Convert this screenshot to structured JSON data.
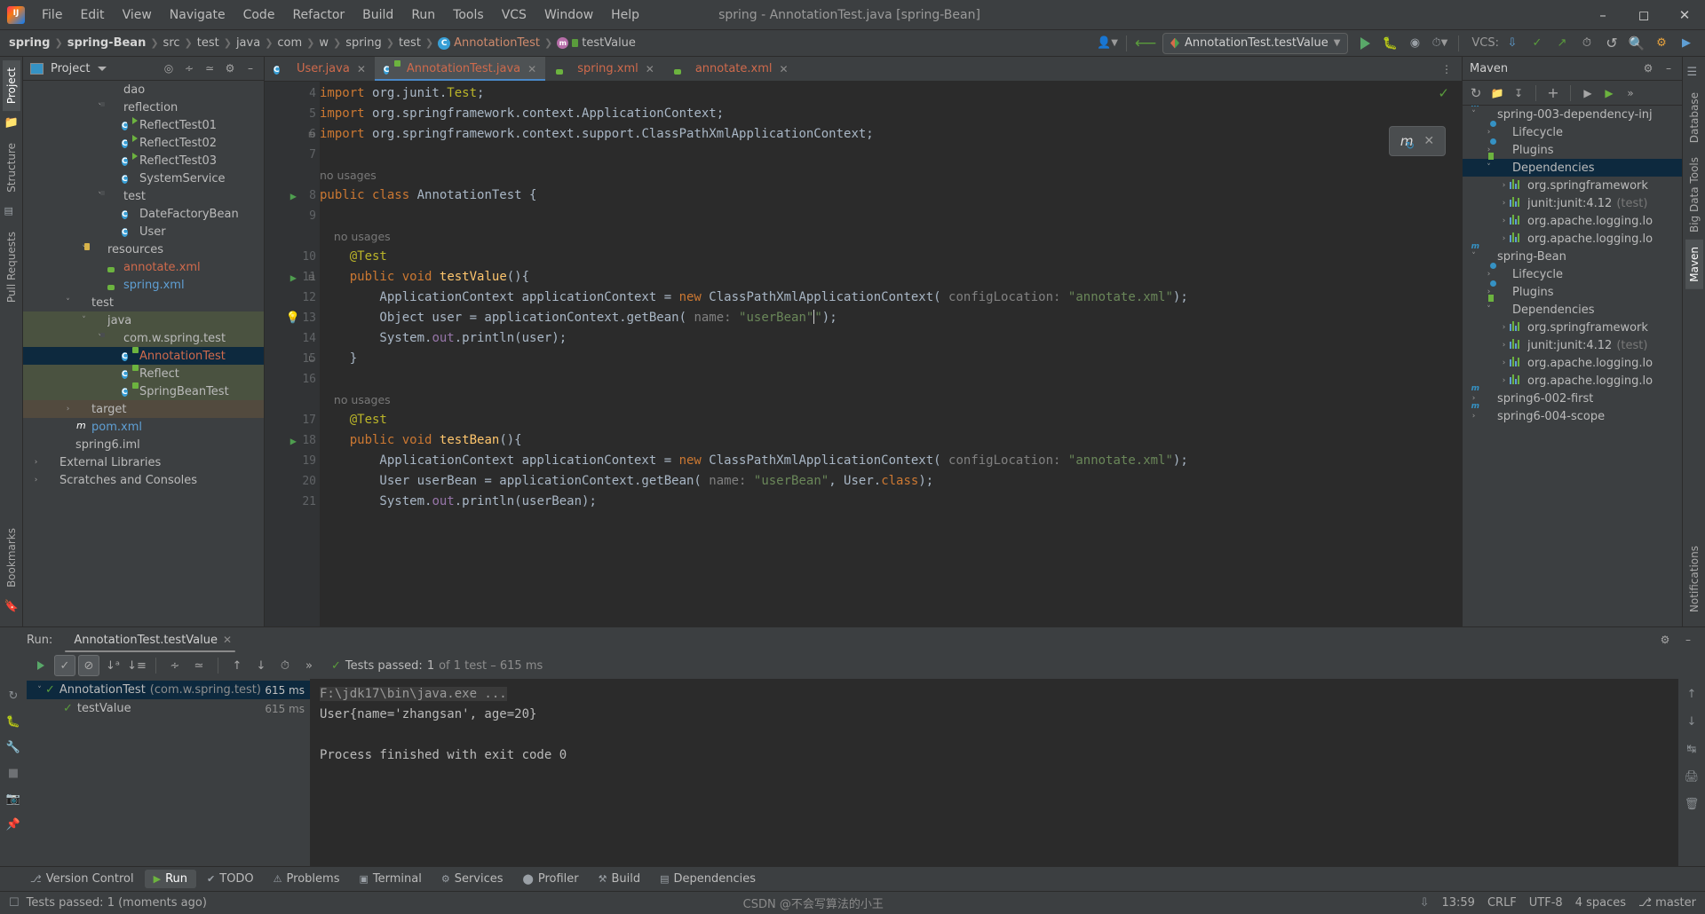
{
  "titlebar": {
    "app_icon": "intellij-logo",
    "menus": [
      "File",
      "Edit",
      "View",
      "Navigate",
      "Code",
      "Refactor",
      "Build",
      "Run",
      "Tools",
      "VCS",
      "Window",
      "Help"
    ],
    "window_title": "spring - AnnotationTest.java [spring-Bean]",
    "controls": [
      "minimize",
      "maximize",
      "close"
    ]
  },
  "navbar": {
    "crumbs": [
      "spring",
      "spring-Bean",
      "src",
      "test",
      "java",
      "com",
      "w",
      "spring",
      "test",
      "AnnotationTest",
      "testValue"
    ],
    "run_config": "AnnotationTest.testValue",
    "vcs_label": "VCS:",
    "icons": [
      "user-icon",
      "back-arrow-icon",
      "run-icon",
      "debug-icon",
      "coverage-icon",
      "profile-icon",
      "search-icon",
      "settings-icon"
    ]
  },
  "left_rail": {
    "tabs": [
      "Project",
      "Structure",
      "Pull Requests"
    ],
    "active_tab": "Project",
    "bottom_tabs": [
      "Bookmarks"
    ]
  },
  "right_rail": {
    "tabs": [
      "Database",
      "Big Data Tools",
      "Maven",
      "Notifications"
    ]
  },
  "project_panel": {
    "title": "Project",
    "actions": [
      "locate-icon",
      "expand-all-icon",
      "collapse-all-icon",
      "gear-icon",
      "minimize-icon"
    ],
    "tree": [
      {
        "indent": 4,
        "arrow": "",
        "icon": "folder",
        "label": "dao",
        "cls": "",
        "sel": ""
      },
      {
        "indent": 4,
        "arrow": "v",
        "icon": "folder-pkg",
        "label": "reflection",
        "cls": "",
        "sel": ""
      },
      {
        "indent": 5,
        "arrow": "",
        "icon": "class-run",
        "label": "ReflectTest01",
        "cls": "",
        "sel": ""
      },
      {
        "indent": 5,
        "arrow": "",
        "icon": "class-run",
        "label": "ReflectTest02",
        "cls": "",
        "sel": ""
      },
      {
        "indent": 5,
        "arrow": "",
        "icon": "class-run",
        "label": "ReflectTest03",
        "cls": "",
        "sel": ""
      },
      {
        "indent": 5,
        "arrow": "",
        "icon": "class",
        "label": "SystemService",
        "cls": "",
        "sel": ""
      },
      {
        "indent": 4,
        "arrow": "v",
        "icon": "folder-pkg",
        "label": "test",
        "cls": "",
        "sel": ""
      },
      {
        "indent": 5,
        "arrow": "",
        "icon": "class",
        "label": "DateFactoryBean",
        "cls": "",
        "sel": ""
      },
      {
        "indent": 5,
        "arrow": "",
        "icon": "class",
        "label": "User",
        "cls": "",
        "sel": ""
      },
      {
        "indent": 3,
        "arrow": "v",
        "icon": "folder-res",
        "label": "resources",
        "cls": "",
        "sel": ""
      },
      {
        "indent": 4,
        "arrow": "",
        "icon": "xml",
        "label": "annotate.xml",
        "cls": "red",
        "sel": ""
      },
      {
        "indent": 4,
        "arrow": "",
        "icon": "xml",
        "label": "spring.xml",
        "cls": "blue",
        "sel": ""
      },
      {
        "indent": 2,
        "arrow": "v",
        "icon": "folder",
        "label": "test",
        "cls": "",
        "sel": ""
      },
      {
        "indent": 3,
        "arrow": "v",
        "icon": "folder-src",
        "label": "java",
        "cls": "",
        "sel": "green"
      },
      {
        "indent": 4,
        "arrow": "v",
        "icon": "folder-pkg",
        "label": "com.w.spring.test",
        "cls": "",
        "sel": "green"
      },
      {
        "indent": 5,
        "arrow": "",
        "icon": "class-test",
        "label": "AnnotationTest",
        "cls": "red",
        "sel": "blue"
      },
      {
        "indent": 5,
        "arrow": "",
        "icon": "class-test",
        "label": "Reflect",
        "cls": "",
        "sel": "green"
      },
      {
        "indent": 5,
        "arrow": "",
        "icon": "class-test",
        "label": "SpringBeanTest",
        "cls": "",
        "sel": "green"
      },
      {
        "indent": 2,
        "arrow": ">",
        "icon": "folder-target",
        "label": "target",
        "cls": "",
        "sel": "brown"
      },
      {
        "indent": 2,
        "arrow": "",
        "icon": "pom",
        "label": "pom.xml",
        "cls": "blue",
        "sel": ""
      },
      {
        "indent": 1,
        "arrow": "",
        "icon": "iml",
        "label": "spring6.iml",
        "cls": "",
        "sel": ""
      },
      {
        "indent": 0,
        "arrow": ">",
        "icon": "lib",
        "label": "External Libraries",
        "cls": "",
        "sel": ""
      },
      {
        "indent": 0,
        "arrow": ">",
        "icon": "lib",
        "label": "Scratches and Consoles",
        "cls": "",
        "sel": ""
      }
    ]
  },
  "editor": {
    "tabs": [
      {
        "label": "User.java",
        "icon": "java-class-icon",
        "active": false,
        "color": "red"
      },
      {
        "label": "AnnotationTest.java",
        "icon": "java-test-icon",
        "active": true,
        "color": "red"
      },
      {
        "label": "spring.xml",
        "icon": "xml-spring-icon",
        "active": false,
        "color": "red"
      },
      {
        "label": "annotate.xml",
        "icon": "xml-spring-icon",
        "active": false,
        "color": "red"
      }
    ],
    "inspection_status": "ok-check",
    "maven_reload_popup": {
      "icon": "maven-reload-icon",
      "close": "x"
    },
    "lines": [
      {
        "num": "4",
        "gutter": "",
        "fold": "",
        "usage": "",
        "html": "<span class=\"kw\">import</span> org.junit.<span class=\"ann\">Test</span>;"
      },
      {
        "num": "5",
        "gutter": "",
        "fold": "",
        "usage": "",
        "html": "<span class=\"kw\">import</span> org.springframework.context.ApplicationContext;"
      },
      {
        "num": "6",
        "gutter": "",
        "fold": "minus",
        "usage": "",
        "html": "<span class=\"kw\">import</span> org.springframework.context.support.ClassPathXmlApplicationContext;"
      },
      {
        "num": "7",
        "gutter": "",
        "fold": "",
        "usage": "",
        "html": ""
      },
      {
        "num": "",
        "gutter": "",
        "fold": "",
        "usage": "no usages",
        "html": ""
      },
      {
        "num": "8",
        "gutter": "run",
        "fold": "",
        "usage": "",
        "html": "<span class=\"kw\">public class</span> <span class=\"typ\">AnnotationTest</span> {"
      },
      {
        "num": "9",
        "gutter": "",
        "fold": "",
        "usage": "",
        "html": ""
      },
      {
        "num": "",
        "gutter": "",
        "fold": "",
        "usage": "    no usages",
        "html": ""
      },
      {
        "num": "10",
        "gutter": "",
        "fold": "",
        "usage": "",
        "html": "    <span class=\"ann\">@Test</span>"
      },
      {
        "num": "11",
        "gutter": "run",
        "fold": "minus",
        "usage": "",
        "html": "    <span class=\"kw\">public</span> <span class=\"kw\">void</span> <span class=\"mth\">testValue</span>(){"
      },
      {
        "num": "12",
        "gutter": "",
        "fold": "",
        "usage": "",
        "html": "        ApplicationContext applicationContext = <span class=\"kw\">new</span> ClassPathXmlApplicationContext( <span class=\"hint\">configLocation:</span> <span class=\"str\">\"annotate.xml\"</span>);"
      },
      {
        "num": "13",
        "gutter": "bulb",
        "fold": "",
        "usage": "",
        "html": "        Object user = applicationContext.getBean( <span class=\"hint\">name:</span> <span class=\"str\">\"userBean\"</span><span class=\"cursor\"></span><span class=\"str\">\"</span>);"
      },
      {
        "num": "14",
        "gutter": "",
        "fold": "",
        "usage": "",
        "html": "        System.<span class=\"fld\">out</span>.println(user);"
      },
      {
        "num": "15",
        "gutter": "",
        "fold": "up",
        "usage": "",
        "html": "    }"
      },
      {
        "num": "16",
        "gutter": "",
        "fold": "",
        "usage": "",
        "html": ""
      },
      {
        "num": "",
        "gutter": "",
        "fold": "",
        "usage": "    no usages",
        "html": ""
      },
      {
        "num": "17",
        "gutter": "",
        "fold": "",
        "usage": "",
        "html": "    <span class=\"ann\">@Test</span>"
      },
      {
        "num": "18",
        "gutter": "run",
        "fold": "",
        "usage": "",
        "html": "    <span class=\"kw\">public</span> <span class=\"kw\">void</span> <span class=\"mth\">testBean</span>(){"
      },
      {
        "num": "19",
        "gutter": "",
        "fold": "",
        "usage": "",
        "html": "        ApplicationContext applicationContext = <span class=\"kw\">new</span> ClassPathXmlApplicationContext( <span class=\"hint\">configLocation:</span> <span class=\"str\">\"annotate.xml\"</span>);"
      },
      {
        "num": "20",
        "gutter": "",
        "fold": "",
        "usage": "",
        "html": "        User userBean = applicationContext.getBean( <span class=\"hint\">name:</span> <span class=\"str\">\"userBean\"</span>, User.<span class=\"kw\">class</span>);"
      },
      {
        "num": "21",
        "gutter": "",
        "fold": "",
        "usage": "",
        "html": "        System.<span class=\"fld\">out</span>.println(userBean);"
      }
    ]
  },
  "maven_panel": {
    "title": "Maven",
    "toolbar_icons": [
      "reload-icon",
      "add-module-icon",
      "download-sources-icon",
      "plus-icon",
      "run-icon",
      "execute-icon",
      "more-icon"
    ],
    "header_icons": [
      "gear-icon",
      "minimize-icon"
    ],
    "tree": [
      {
        "indent": 0,
        "arrow": "v",
        "icon": "module",
        "label": "spring-003-dependency-inj",
        "dim": "",
        "sel": false
      },
      {
        "indent": 1,
        "arrow": ">",
        "icon": "lifecycle",
        "label": "Lifecycle",
        "dim": "",
        "sel": false
      },
      {
        "indent": 1,
        "arrow": ">",
        "icon": "plugins",
        "label": "Plugins",
        "dim": "",
        "sel": false
      },
      {
        "indent": 1,
        "arrow": "v",
        "icon": "deps",
        "label": "Dependencies",
        "dim": "",
        "sel": true
      },
      {
        "indent": 2,
        "arrow": ">",
        "icon": "bars",
        "label": "org.springframework",
        "dim": "",
        "sel": false
      },
      {
        "indent": 2,
        "arrow": ">",
        "icon": "bars",
        "label": "junit:junit:4.12",
        "dim": "(test)",
        "sel": false
      },
      {
        "indent": 2,
        "arrow": ">",
        "icon": "bars",
        "label": "org.apache.logging.lo",
        "dim": "",
        "sel": false
      },
      {
        "indent": 2,
        "arrow": ">",
        "icon": "bars",
        "label": "org.apache.logging.lo",
        "dim": "",
        "sel": false
      },
      {
        "indent": 0,
        "arrow": "v",
        "icon": "module",
        "label": "spring-Bean",
        "dim": "",
        "sel": false
      },
      {
        "indent": 1,
        "arrow": ">",
        "icon": "lifecycle",
        "label": "Lifecycle",
        "dim": "",
        "sel": false
      },
      {
        "indent": 1,
        "arrow": ">",
        "icon": "plugins",
        "label": "Plugins",
        "dim": "",
        "sel": false
      },
      {
        "indent": 1,
        "arrow": "v",
        "icon": "deps",
        "label": "Dependencies",
        "dim": "",
        "sel": false
      },
      {
        "indent": 2,
        "arrow": ">",
        "icon": "bars",
        "label": "org.springframework",
        "dim": "",
        "sel": false
      },
      {
        "indent": 2,
        "arrow": ">",
        "icon": "bars",
        "label": "junit:junit:4.12",
        "dim": "(test)",
        "sel": false
      },
      {
        "indent": 2,
        "arrow": ">",
        "icon": "bars",
        "label": "org.apache.logging.lo",
        "dim": "",
        "sel": false
      },
      {
        "indent": 2,
        "arrow": ">",
        "icon": "bars",
        "label": "org.apache.logging.lo",
        "dim": "",
        "sel": false
      },
      {
        "indent": 0,
        "arrow": ">",
        "icon": "module",
        "label": "spring6-002-first",
        "dim": "",
        "sel": false
      },
      {
        "indent": 0,
        "arrow": ">",
        "icon": "module",
        "label": "spring6-004-scope",
        "dim": "",
        "sel": false
      }
    ]
  },
  "run_panel": {
    "label": "Run:",
    "tab_title": "AnnotationTest.testValue",
    "toolbar_icons": [
      "rerun-icon",
      "show-passed-icon",
      "show-ignored-icon",
      "sort-alpha-icon",
      "sort-duration-icon",
      "expand-all-icon",
      "collapse-all-icon",
      "prev-failed-icon",
      "next-failed-icon",
      "history-icon",
      "more-icon"
    ],
    "status_prefix": "Tests passed:",
    "status_count": "1",
    "status_suffix": "of 1 test – 615 ms",
    "header_actions": [
      "gear-icon",
      "minimize-icon"
    ],
    "tests": [
      {
        "indent": 0,
        "arrow": "v",
        "name": "AnnotationTest",
        "pkg": "(com.w.spring.test)",
        "ms": "615 ms",
        "sel": true
      },
      {
        "indent": 1,
        "arrow": "",
        "name": "testValue",
        "pkg": "",
        "ms": "615 ms",
        "sel": false
      }
    ],
    "console": [
      {
        "text": "F:\\jdk17\\bin\\java.exe ...",
        "cmd": true
      },
      {
        "text": "User{name='zhangsan', age=20}",
        "cmd": false
      },
      {
        "text": "",
        "cmd": false
      },
      {
        "text": "Process finished with exit code 0",
        "cmd": false
      }
    ]
  },
  "toolwindow_bar": {
    "items": [
      {
        "label": "Version Control",
        "icon": "branch-icon",
        "active": false
      },
      {
        "label": "Run",
        "icon": "run-icon",
        "active": true
      },
      {
        "label": "TODO",
        "icon": "todo-icon",
        "active": false
      },
      {
        "label": "Problems",
        "icon": "problems-icon",
        "active": false
      },
      {
        "label": "Terminal",
        "icon": "terminal-icon",
        "active": false
      },
      {
        "label": "Services",
        "icon": "services-icon",
        "active": false
      },
      {
        "label": "Profiler",
        "icon": "profiler-icon",
        "active": false
      },
      {
        "label": "Build",
        "icon": "build-icon",
        "active": false
      },
      {
        "label": "Dependencies",
        "icon": "dependencies-icon",
        "active": false
      }
    ]
  },
  "statusbar": {
    "message": "Tests passed: 1 (moments ago)",
    "time": "13:59",
    "line_sep": "CRLF",
    "encoding": "UTF-8",
    "indent": "4 spaces",
    "branch": "master",
    "watermark": "CSDN @不会写算法的小王"
  }
}
